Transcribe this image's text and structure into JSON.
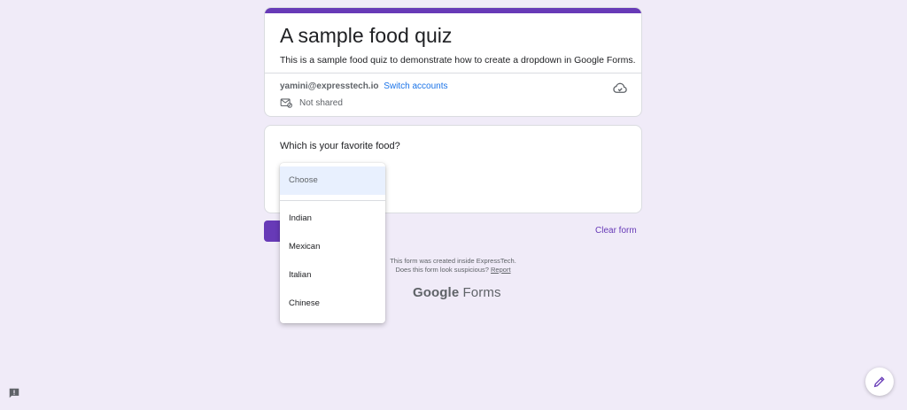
{
  "header": {
    "title": "A sample food quiz",
    "description": "This is a sample food quiz to demonstrate how to create a dropdown in Google Forms.",
    "account_email": "yamini@expresstech.io",
    "switch_accounts": "Switch accounts",
    "share_status": "Not shared",
    "accent_color": "#673ab7"
  },
  "question": {
    "text": "Which is your favorite food?",
    "dropdown": {
      "placeholder": "Choose",
      "options": [
        "Indian",
        "Mexican",
        "Italian",
        "Chinese"
      ]
    }
  },
  "actions": {
    "clear_form": "Clear form"
  },
  "footer": {
    "line1": "This form was created inside ExpressTech.",
    "line2": "Does this form look suspicious?",
    "report": "Report",
    "logo_google": "Google",
    "logo_forms": "Forms"
  },
  "icons": {
    "cloud": "cloud-icon",
    "not_shared": "not-shared-icon",
    "feedback": "feedback-icon",
    "edit": "edit-icon"
  }
}
